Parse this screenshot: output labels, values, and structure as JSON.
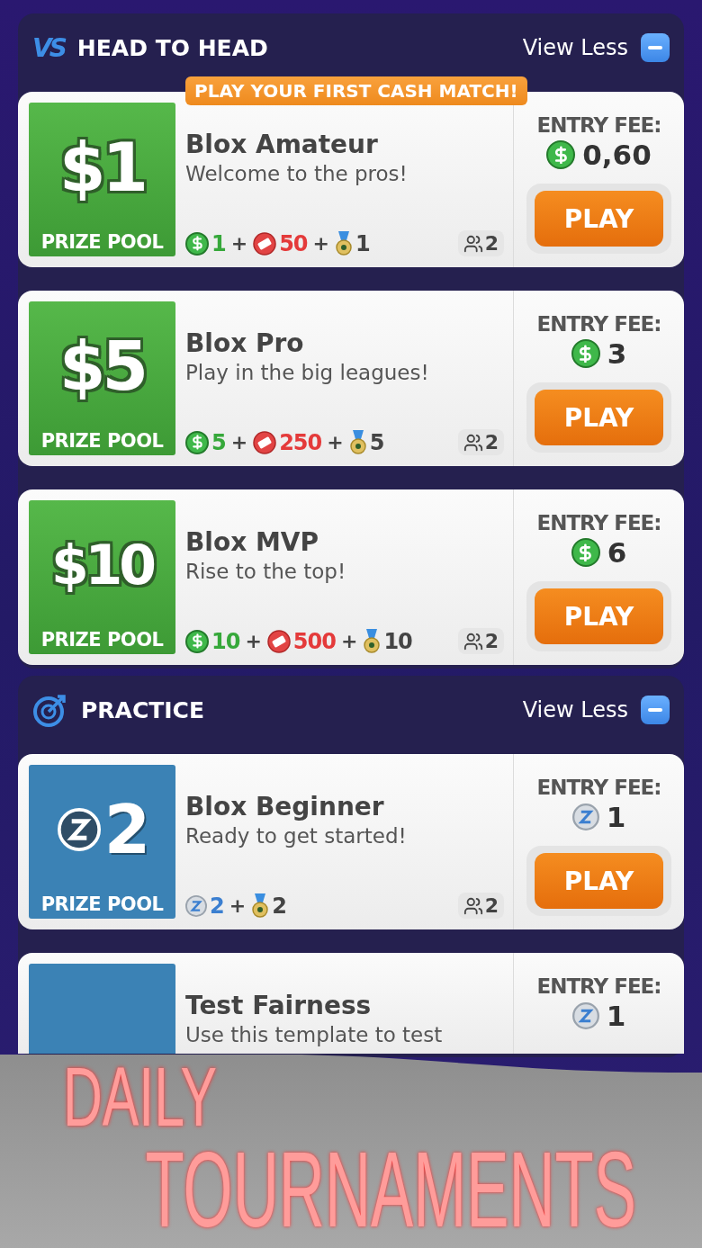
{
  "sections": [
    {
      "logo": "VS",
      "title": "HEAD TO HEAD",
      "toggle": "View Less",
      "expanded": true,
      "cards": [
        {
          "kind": "cash",
          "banner": "PLAY YOUR FIRST CASH MATCH!",
          "prize": "$1",
          "prize_label": "PRIZE POOL",
          "title": "Blox Amateur",
          "description": "Welcome to the pros!",
          "rewards": [
            {
              "kind": "cash",
              "amount": "1"
            },
            {
              "kind": "ticket",
              "prefix": "+",
              "amount": "50"
            },
            {
              "kind": "medal",
              "prefix": "+",
              "amount": "1"
            }
          ],
          "players": "2",
          "entry_label": "ENTRY FEE:",
          "entry_fee": "0,60",
          "button": "PLAY"
        },
        {
          "kind": "cash",
          "prize": "$5",
          "prize_label": "PRIZE POOL",
          "title": "Blox Pro",
          "description": "Play in the big leagues!",
          "rewards": [
            {
              "kind": "cash",
              "amount": "5"
            },
            {
              "kind": "ticket",
              "prefix": "+",
              "amount": "250"
            },
            {
              "kind": "medal",
              "prefix": "+",
              "amount": "5"
            }
          ],
          "players": "2",
          "entry_label": "ENTRY FEE:",
          "entry_fee": "3",
          "button": "PLAY"
        },
        {
          "kind": "cash",
          "prize": "$10",
          "prize_label": "PRIZE POOL",
          "title": "Blox MVP",
          "description": "Rise to the top!",
          "rewards": [
            {
              "kind": "cash",
              "amount": "10"
            },
            {
              "kind": "ticket",
              "prefix": "+",
              "amount": "500"
            },
            {
              "kind": "medal",
              "prefix": "+",
              "amount": "10"
            }
          ],
          "players": "2",
          "entry_label": "ENTRY FEE:",
          "entry_fee": "6",
          "button": "PLAY"
        }
      ]
    },
    {
      "title": "PRACTICE",
      "toggle": "View Less",
      "expanded": true,
      "cards": [
        {
          "kind": "practice",
          "prize": "2",
          "prize_label": "PRIZE POOL",
          "title": "Blox Beginner",
          "description": "Ready to get started!",
          "rewards": [
            {
              "kind": "z",
              "amount": "2"
            },
            {
              "kind": "medal",
              "prefix": "+",
              "amount": "2"
            }
          ],
          "players": "2",
          "entry_label": "ENTRY FEE:",
          "entry_fee": "1",
          "button": "PLAY"
        },
        {
          "kind": "practice",
          "title": "Test Fairness",
          "description": "Use this template to test",
          "entry_label": "ENTRY FEE:",
          "entry_fee": "1"
        }
      ]
    }
  ],
  "promo": {
    "line_1": "DAILY",
    "line_2": "TOURNAMENTS"
  }
}
